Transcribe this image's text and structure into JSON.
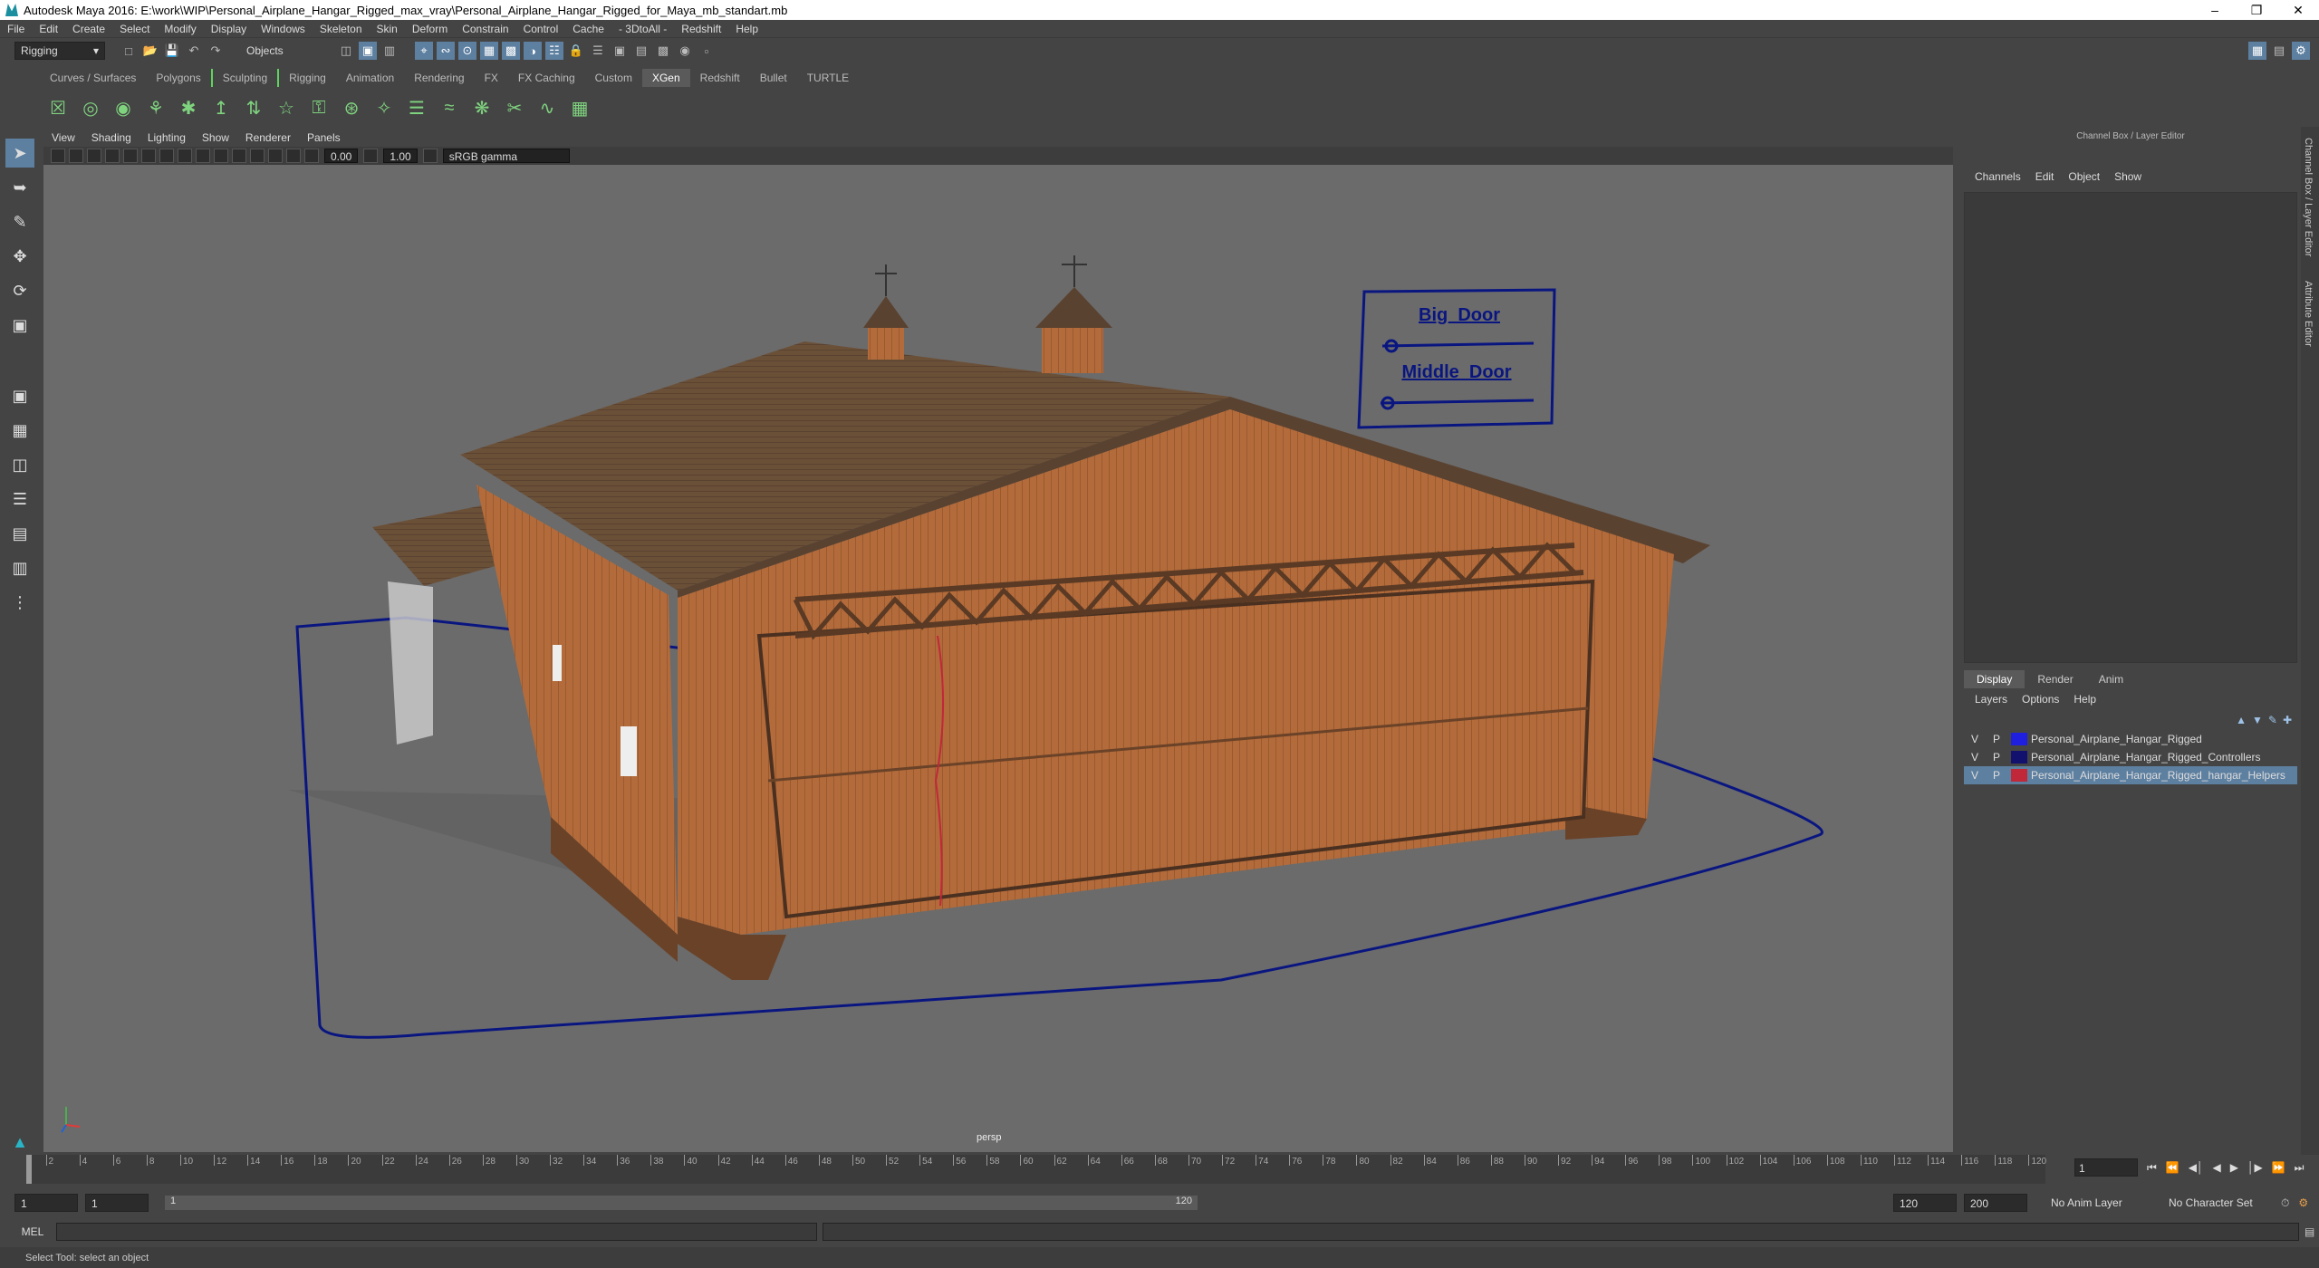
{
  "window": {
    "title": "Autodesk Maya 2016: E:\\work\\WIP\\Personal_Airplane_Hangar_Rigged_max_vray\\Personal_Airplane_Hangar_Rigged_for_Maya_mb_standart.mb"
  },
  "menubar": [
    "File",
    "Edit",
    "Create",
    "Select",
    "Modify",
    "Display",
    "Windows",
    "Skeleton",
    "Skin",
    "Deform",
    "Constrain",
    "Control",
    "Cache",
    "- 3DtoAll -",
    "Redshift",
    "Help"
  ],
  "statusline": {
    "mode": "Rigging",
    "select_mode": "Objects"
  },
  "shelf_tabs": [
    "Curves / Surfaces",
    "Polygons",
    "Sculpting",
    "Rigging",
    "Animation",
    "Rendering",
    "FX",
    "FX Caching",
    "Custom",
    "XGen",
    "Redshift",
    "Bullet",
    "TURTLE"
  ],
  "shelf_active": "XGen",
  "viewport": {
    "menu": [
      "View",
      "Shading",
      "Lighting",
      "Show",
      "Renderer",
      "Panels"
    ],
    "exposure": "0.00",
    "gamma": "1.00",
    "colorspace": "sRGB gamma",
    "camera_label": "persp",
    "controls": [
      "Big_Door",
      "Middle_Door"
    ]
  },
  "channel_box": {
    "title": "Channel Box / Layer Editor",
    "menu": [
      "Channels",
      "Edit",
      "Object",
      "Show"
    ]
  },
  "layer_editor": {
    "tabs": [
      "Display",
      "Render",
      "Anim"
    ],
    "menu": [
      "Layers",
      "Options",
      "Help"
    ],
    "layers": [
      {
        "v": "V",
        "p": "P",
        "color": "#1f1fe0",
        "name": "Personal_Airplane_Hangar_Rigged"
      },
      {
        "v": "V",
        "p": "P",
        "color": "#12126e",
        "name": "Personal_Airplane_Hangar_Rigged_Controllers"
      },
      {
        "v": "V",
        "p": "P",
        "color": "#c0283a",
        "name": "Personal_Airplane_Hangar_Rigged_hangar_Helpers"
      }
    ]
  },
  "side_tabs": [
    "Channel Box / Layer Editor",
    "Attribute Editor"
  ],
  "timeline": {
    "ticks": [
      "2",
      "4",
      "6",
      "8",
      "10",
      "12",
      "14",
      "16",
      "18",
      "20",
      "22",
      "24",
      "26",
      "28",
      "30",
      "32",
      "34",
      "36",
      "38",
      "40",
      "42",
      "44",
      "46",
      "48",
      "50",
      "52",
      "54",
      "56",
      "58",
      "60",
      "62",
      "64",
      "66",
      "68",
      "70",
      "72",
      "74",
      "76",
      "78",
      "80",
      "82",
      "84",
      "86",
      "88",
      "90",
      "92",
      "94",
      "96",
      "98",
      "100",
      "102",
      "104",
      "106",
      "108",
      "110",
      "112",
      "114",
      "116",
      "118",
      "120"
    ],
    "current_frame": "1"
  },
  "range": {
    "start": "1",
    "playback_start": "1",
    "range_inner_start": "1",
    "range_inner_end": "120",
    "playback_end": "120",
    "end": "200",
    "anim_layer": "No Anim Layer",
    "character_set": "No Character Set"
  },
  "command": {
    "lang": "MEL"
  },
  "help_line": "Select Tool: select an object"
}
